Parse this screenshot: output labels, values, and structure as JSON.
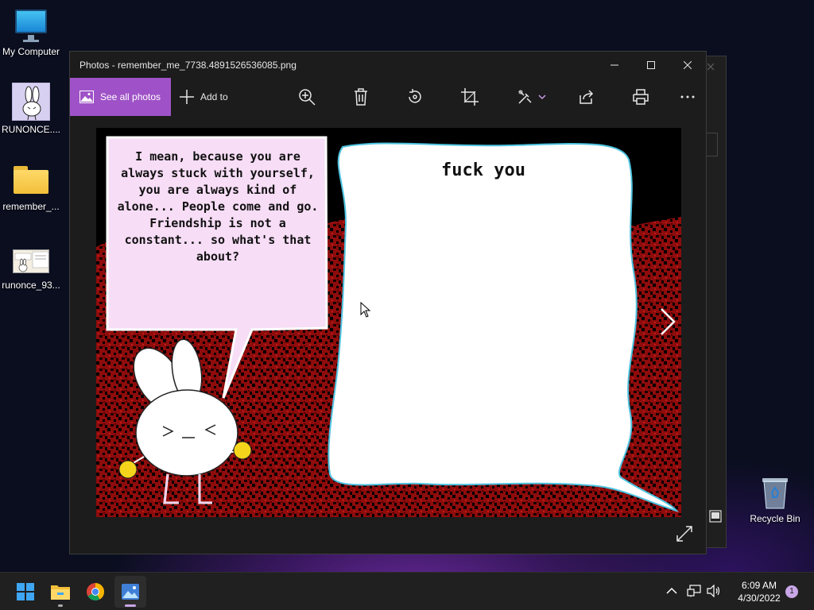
{
  "desktop": {
    "icons": [
      {
        "label": "My Computer",
        "icon": "monitor-icon"
      },
      {
        "label": "RUNONCE....",
        "icon": "bunny-thumbnail-icon"
      },
      {
        "label": "remember_...",
        "icon": "folder-icon"
      },
      {
        "label": "runonce_93...",
        "icon": "image-thumbnail-icon"
      },
      {
        "label": "Recycle Bin",
        "icon": "recycle-bin-icon"
      }
    ]
  },
  "photos_window": {
    "title": "Photos - remember_me_7738.4891526536085.png",
    "toolbar": {
      "see_all_label": "See all photos",
      "add_to_label": "Add to",
      "tools": [
        "zoom-in-icon",
        "delete-icon",
        "rotate-icon",
        "crop-icon",
        "edit-icon",
        "share-icon",
        "print-icon",
        "more-icon"
      ]
    },
    "image": {
      "left_bubble_text": "I mean, because you are always stuck with yourself, you are always kind of alone... People come and go. Friendship is not a constant... so what's that about?",
      "right_bubble_text": "fuck you"
    }
  },
  "taskbar": {
    "apps": [
      "start-icon",
      "file-explorer-icon",
      "chrome-icon",
      "photos-icon"
    ],
    "clock_time": "6:09 AM",
    "clock_date": "4/30/2022",
    "notification_count": "1"
  },
  "colors": {
    "accent": "#9f52c7",
    "window_bg": "#1c1c1c",
    "taskbar_bg": "#202020"
  }
}
